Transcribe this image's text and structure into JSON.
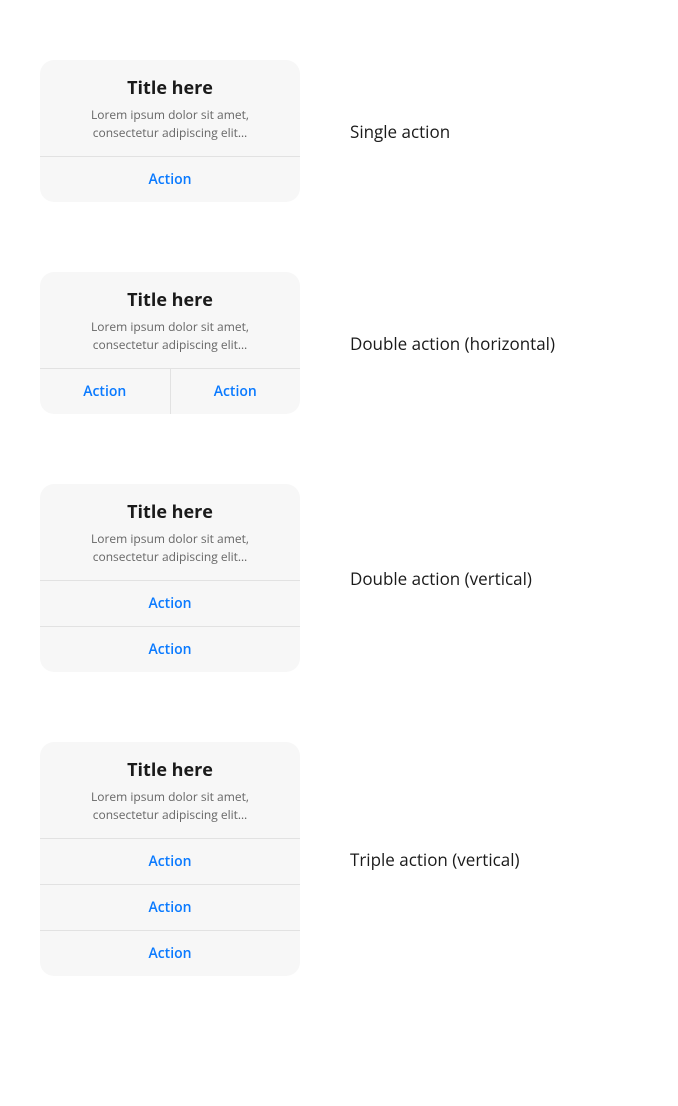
{
  "examples": [
    {
      "title": "Title here",
      "desc": "Lorem ipsum dolor sit amet, consectetur adipiscing elit…",
      "actions": [
        "Action"
      ],
      "layout": "single",
      "caption": "Single action"
    },
    {
      "title": "Title here",
      "desc": "Lorem ipsum dolor sit amet, consectetur adipiscing elit…",
      "actions": [
        "Action",
        "Action"
      ],
      "layout": "horizontal",
      "caption": "Double action (horizontal)"
    },
    {
      "title": "Title here",
      "desc": "Lorem ipsum dolor sit amet, consectetur adipiscing elit…",
      "actions": [
        "Action",
        "Action"
      ],
      "layout": "vertical",
      "caption": "Double action (vertical)"
    },
    {
      "title": "Title here",
      "desc": "Lorem ipsum dolor sit amet, consectetur adipiscing elit…",
      "actions": [
        "Action",
        "Action",
        "Action"
      ],
      "layout": "vertical",
      "caption": "Triple action (vertical)"
    }
  ],
  "colors": {
    "card_bg": "#f7f7f7",
    "border": "#e2e2e2",
    "action": "#0a7aff",
    "text": "#1a1a1a",
    "muted": "#666"
  }
}
